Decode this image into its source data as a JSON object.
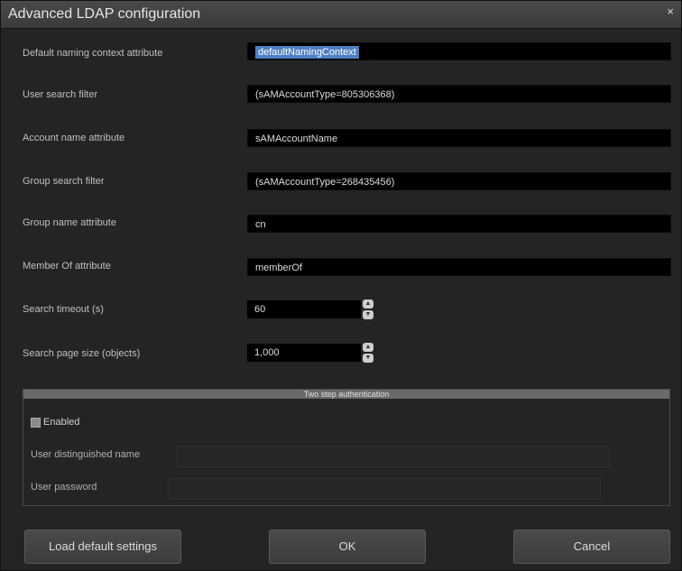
{
  "window": {
    "title": "Advanced LDAP configuration",
    "close": "×"
  },
  "fields": [
    {
      "label": "Default naming context attribute",
      "value": "defaultNamingContext",
      "selected": true
    },
    {
      "label": "User search filter",
      "value": "(sAMAccountType=805306368)"
    },
    {
      "label": "Account name attribute",
      "value": "sAMAccountName"
    },
    {
      "label": "Group search filter",
      "value": "(sAMAccountType=268435456)"
    },
    {
      "label": "Group name attribute",
      "value": "cn"
    },
    {
      "label": "Member Of attribute",
      "value": "memberOf"
    }
  ],
  "spinners": [
    {
      "label": "Search timeout (s)",
      "value": "60"
    },
    {
      "label": "Search page size (objects)",
      "value": "1,000"
    }
  ],
  "auth": {
    "title": "Two step authentication",
    "enabled_label": "Enabled",
    "dn_label": "User distinguished name",
    "dn_value": "",
    "password_label": "User password",
    "password_value": ""
  },
  "buttons": {
    "load_defaults": "Load default settings",
    "ok": "OK",
    "cancel": "Cancel"
  }
}
